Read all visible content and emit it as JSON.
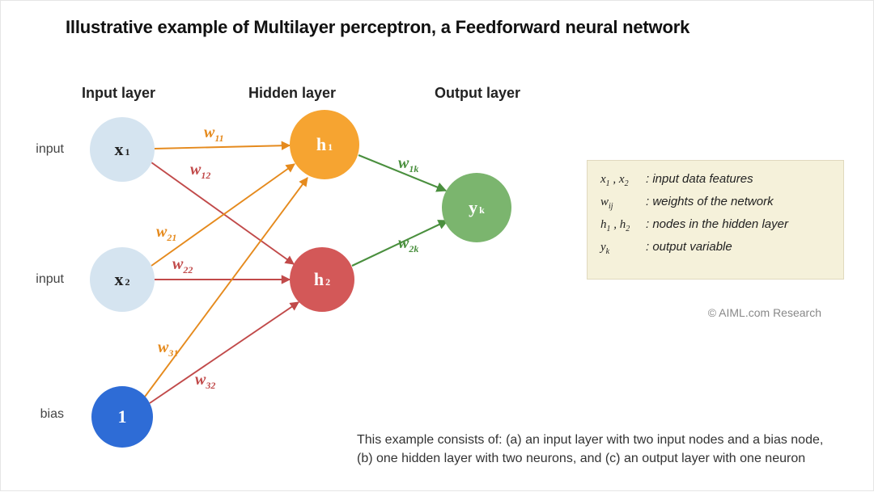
{
  "title": "Illustrative example of Multilayer perceptron, a Feedforward neural network",
  "labels": {
    "input_layer": "Input layer",
    "hidden_layer": "Hidden layer",
    "output_layer": "Output layer",
    "input": "input",
    "bias": "bias"
  },
  "nodes": {
    "x1": {
      "base": "x",
      "sub": "1"
    },
    "x2": {
      "base": "x",
      "sub": "2"
    },
    "bias": {
      "base": "1",
      "sub": ""
    },
    "h1": {
      "base": "h",
      "sub": "1"
    },
    "h2": {
      "base": "h",
      "sub": "2"
    },
    "y": {
      "base": "y",
      "sub": "k"
    }
  },
  "weights": {
    "w11": {
      "base": "w",
      "sub": "11"
    },
    "w12": {
      "base": "w",
      "sub": "12"
    },
    "w21": {
      "base": "w",
      "sub": "21"
    },
    "w22": {
      "base": "w",
      "sub": "22"
    },
    "w31": {
      "base": "w",
      "sub": "31"
    },
    "w32": {
      "base": "w",
      "sub": "32"
    },
    "w1k": {
      "base": "w",
      "sub": "1k"
    },
    "w2k": {
      "base": "w",
      "sub": "2k"
    }
  },
  "legend": {
    "row1": {
      "key_html": "x<sub class='lsub'>1</sub> , x<sub class='lsub'>2</sub>",
      "desc": ": input data features"
    },
    "row2": {
      "key_html": "w<sub class='lsub'>ij</sub>",
      "desc": ": weights of the network"
    },
    "row3": {
      "key_html": "h<sub class='lsub'>1</sub> , h<sub class='lsub'>2</sub>",
      "desc": ": nodes in the hidden layer"
    },
    "row4": {
      "key_html": "y<sub class='lsub'>k</sub>",
      "desc": ": output variable"
    }
  },
  "credit": "© AIML.com Research",
  "caption": "This example consists of:  (a) an input layer with two input nodes and a bias node, (b) one hidden layer with two neurons, and (c) an output layer with one neuron",
  "colors": {
    "orange": "#e58a1d",
    "red": "#c14a4a",
    "green": "#4a8f3e"
  }
}
